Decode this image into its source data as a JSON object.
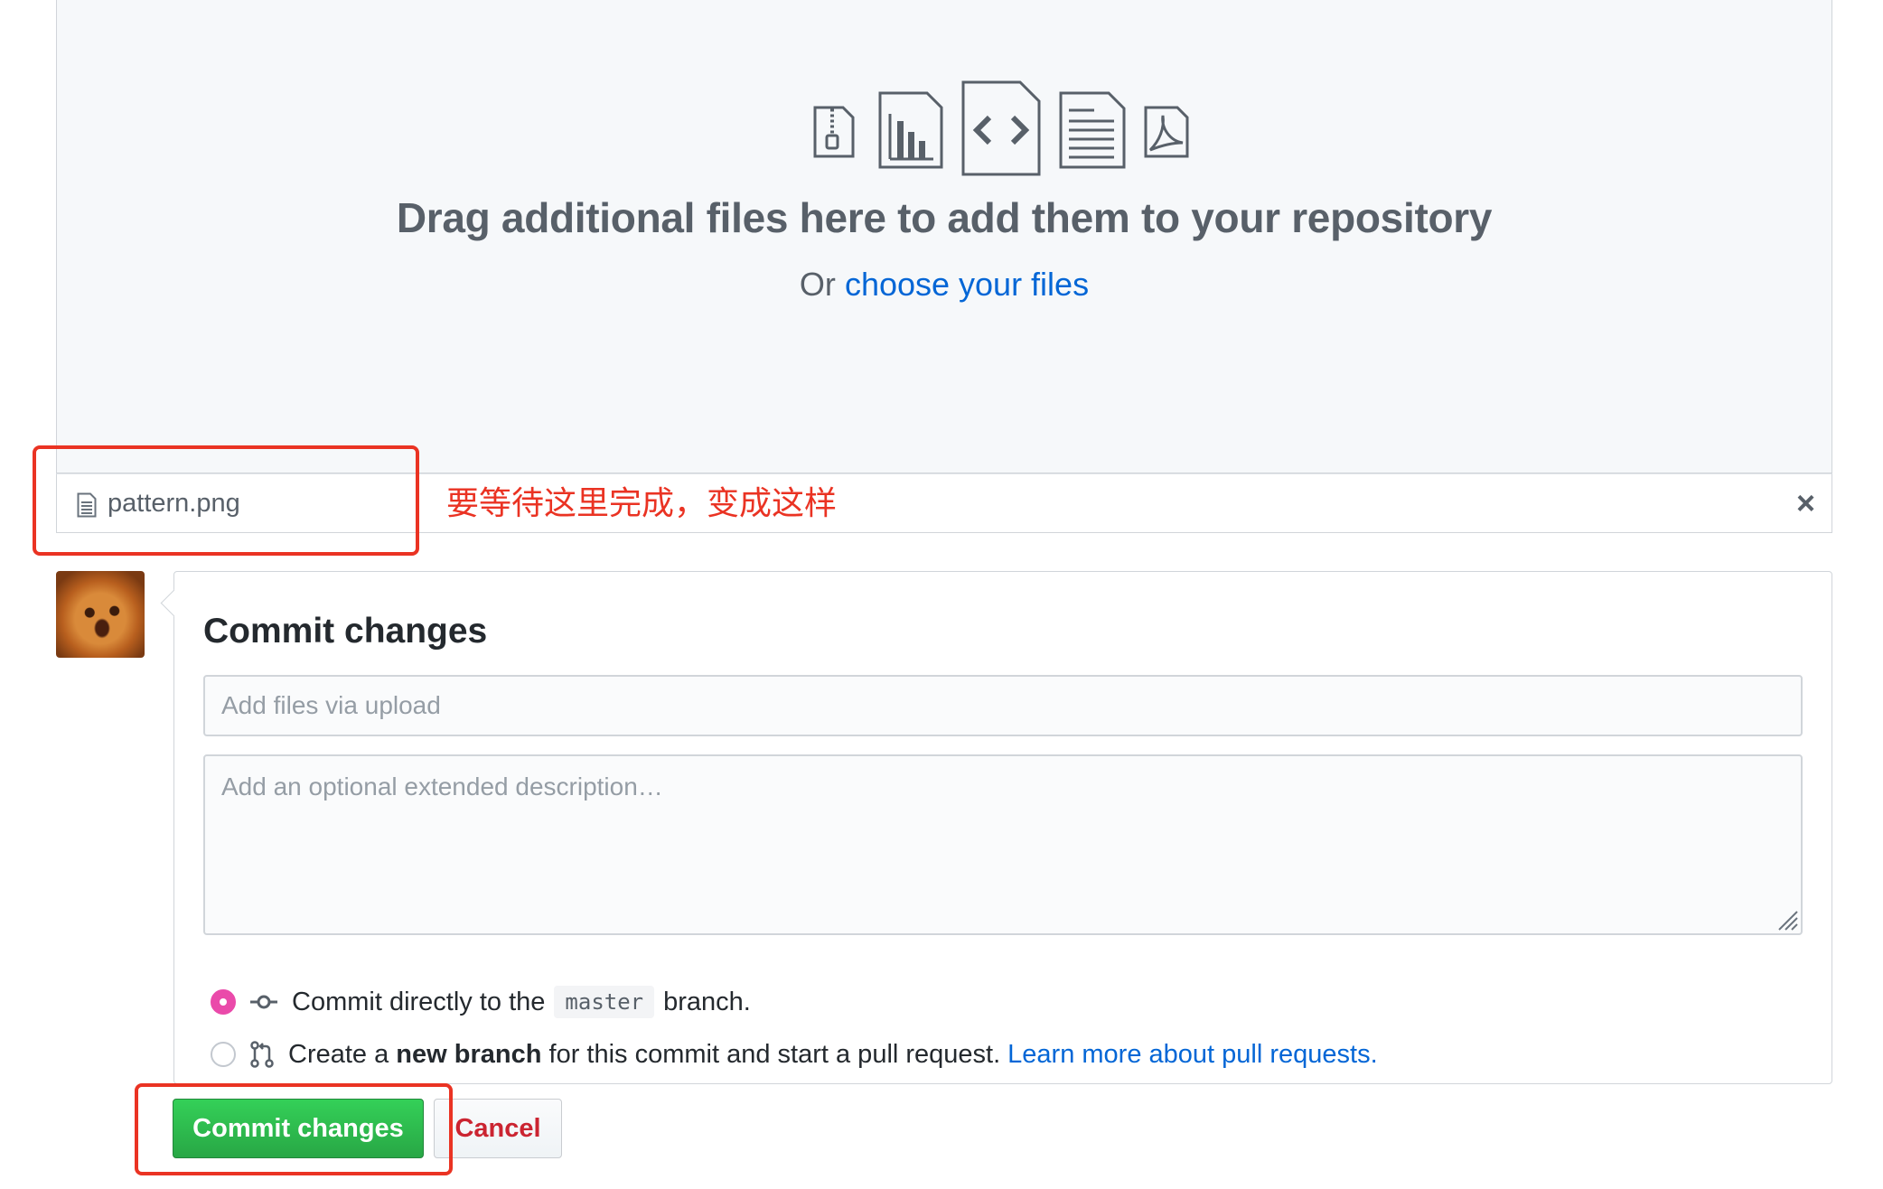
{
  "dropzone": {
    "icons": [
      "zip-file-icon",
      "chart-file-icon",
      "code-file-icon",
      "text-file-icon",
      "pdf-file-icon"
    ],
    "title": "Drag additional files here to add them to your repository",
    "or_text": "Or",
    "choose_link": "choose your files"
  },
  "file": {
    "name": "pattern.png",
    "icon": "file-icon",
    "remove_label": "×"
  },
  "annotation": {
    "text": "要等待这里完成，变成这样",
    "color": "#ea3323"
  },
  "commit": {
    "title": "Commit changes",
    "summary_placeholder": "Add files via upload",
    "description_placeholder": "Add an optional extended description…",
    "option_direct": {
      "prefix": "Commit directly to the",
      "branch": "master",
      "suffix": "branch.",
      "selected": true
    },
    "option_new_branch": {
      "prefix": "Create a",
      "bold": "new branch",
      "suffix": "for this commit and start a pull request.",
      "link": "Learn more about pull requests.",
      "selected": false
    }
  },
  "buttons": {
    "commit": "Commit changes",
    "cancel": "Cancel"
  },
  "colors": {
    "primary_green": "#28a745",
    "link_blue": "#0366d6",
    "danger_red": "#cb2431",
    "radio_pink": "#ea4aaa"
  }
}
